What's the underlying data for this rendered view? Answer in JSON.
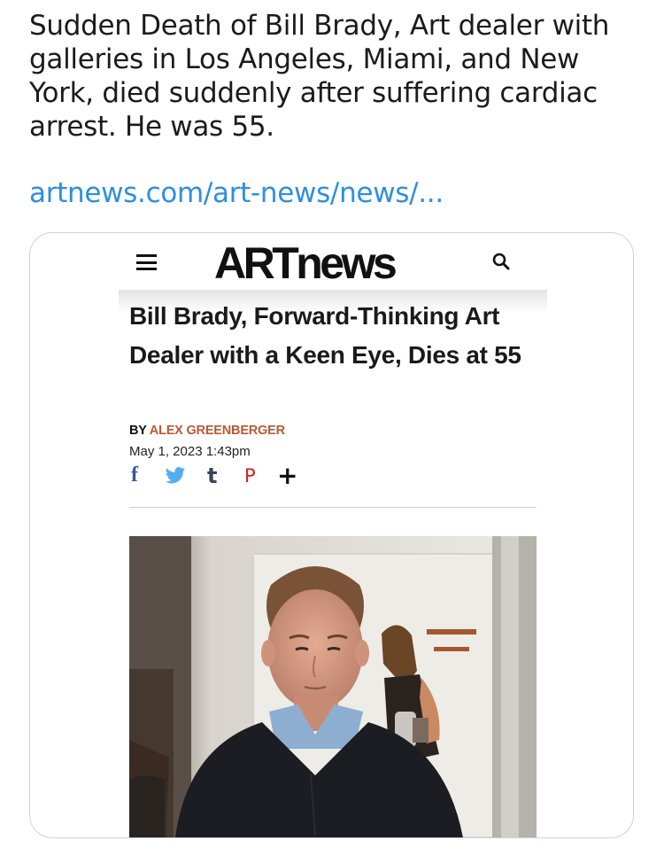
{
  "tweet": {
    "text": "Sudden Death of Bill Brady, Art dealer with galleries in Los Angeles, Miami, and New York, died suddenly after suffering cardiac arrest. He was 55.",
    "link": "artnews.com/art-news/news/..."
  },
  "card": {
    "site_logo": "ARTnews",
    "icons": {
      "menu": "hamburger-menu-icon",
      "search": "magnifier-icon"
    },
    "article": {
      "headline": "Bill Brady, Forward-Thinking Art Dealer with a Keen Eye, Dies at 55",
      "byline_prefix": "BY",
      "author": "ALEX GREENBERGER",
      "date": "May 1, 2023 1:43pm",
      "share_icons": [
        {
          "name": "facebook-icon",
          "glyph": "f",
          "color": "#3b5998"
        },
        {
          "name": "twitter-icon",
          "glyph": "twitter bird",
          "color": "#55acee"
        },
        {
          "name": "tumblr-icon",
          "glyph": "t",
          "color": "#35465c"
        },
        {
          "name": "pinterest-icon",
          "glyph": "p",
          "color": "#cb2027"
        },
        {
          "name": "more-share-icon",
          "glyph": "+",
          "color": "#111111"
        }
      ]
    }
  },
  "colors": {
    "link": "#2f8ee0",
    "author": "#b65a36",
    "card_border": "#cfd3d8"
  }
}
